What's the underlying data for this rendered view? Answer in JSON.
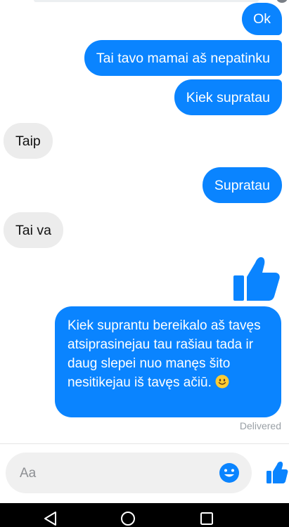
{
  "messages": [
    {
      "id": "m-ok",
      "direction": "outgoing",
      "text": "Ok"
    },
    {
      "id": "m-mamai",
      "direction": "outgoing",
      "text": "Tai tavo mamai aš nepatinku"
    },
    {
      "id": "m-kiek",
      "direction": "outgoing",
      "text": "Kiek supratau"
    },
    {
      "id": "m-taip",
      "direction": "incoming",
      "text": "Taip"
    },
    {
      "id": "m-supratau",
      "direction": "outgoing",
      "text": "Supratau"
    },
    {
      "id": "m-taiva",
      "direction": "incoming",
      "text": "Tai va"
    },
    {
      "id": "thumb-big",
      "direction": "outgoing",
      "type": "like-sticker"
    },
    {
      "id": "m-long",
      "direction": "outgoing",
      "text": "Kiek suprantu bereikalo aš tavęs atsiprasinejau tau rašiau tada ir daug slepei nuo manęs šito nesitikejau iš tavęs ačiū.",
      "emoji": "slightly-smiling-face"
    }
  ],
  "status": {
    "delivered": "Delivered"
  },
  "composer": {
    "placeholder": "Aa",
    "emoji_icon": "smiley-icon",
    "send_icon": "thumbs-up-icon"
  },
  "navigation": {
    "icons": [
      "back-triangle-icon",
      "home-circle-icon",
      "recent-apps-square-icon"
    ]
  },
  "colors": {
    "outgoing_bubble": "#0a84ff",
    "incoming_bubble": "#ececec",
    "accent": "#0a84ff",
    "emoji_yellow": "#ffcc33",
    "nav_bar": "#000000"
  }
}
